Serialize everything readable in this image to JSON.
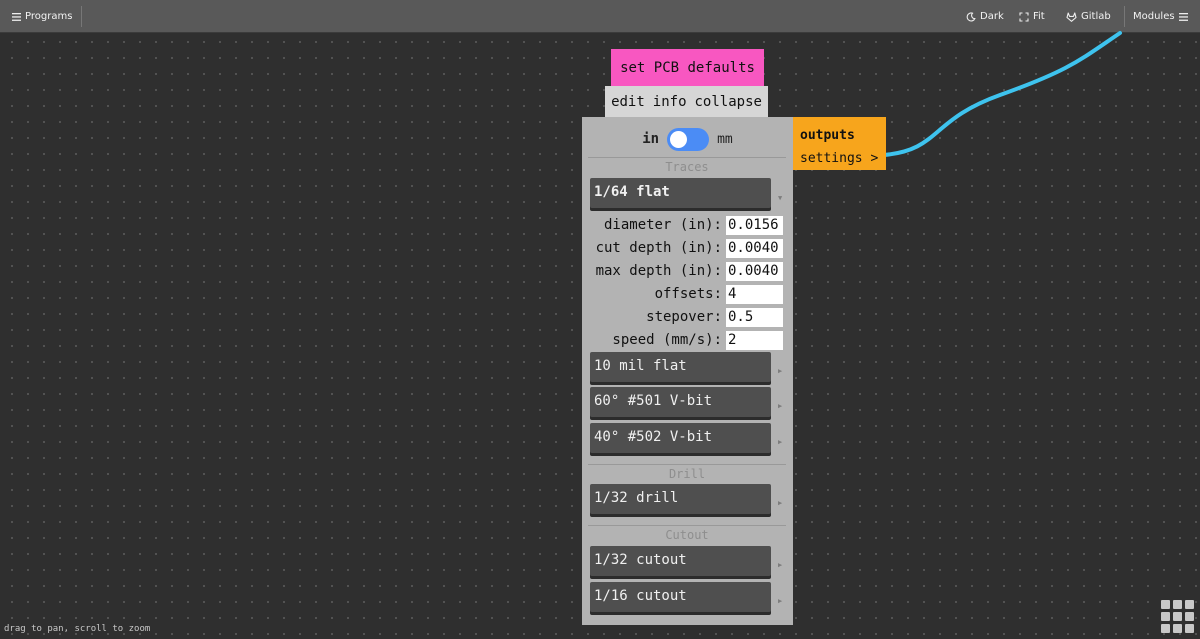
{
  "topbar": {
    "programs_label": "Programs",
    "dark_label": "Dark",
    "fit_label": "Fit",
    "gitlab_label": "Gitlab",
    "modules_label": "Modules"
  },
  "node": {
    "title": "set PCB defaults",
    "tabs": {
      "edit": "edit",
      "info": "info",
      "collapse": "collapse"
    },
    "units": {
      "left": "in",
      "right": "mm"
    },
    "outputs": {
      "title": "outputs",
      "port": "settings >"
    },
    "sections": {
      "traces": "Traces",
      "drill": "Drill",
      "cutout": "Cutout"
    },
    "tools": {
      "t1": "1/64 flat",
      "t2": "10 mil flat",
      "t3": "60° #501 V-bit",
      "t4": "40° #502 V-bit",
      "t5": "1/32 drill",
      "t6": "1/32 cutout",
      "t7": "1/16 cutout"
    },
    "arrow_expanded": "▼",
    "arrow_collapsed": "▶",
    "params": {
      "diameter": {
        "label": "diameter (in):",
        "value": "0.0156"
      },
      "cut_depth": {
        "label": "cut depth (in):",
        "value": "0.0040"
      },
      "max_depth": {
        "label": "max depth (in):",
        "value": "0.0040"
      },
      "offsets": {
        "label": "offsets:",
        "value": "4"
      },
      "stepover": {
        "label": "stepover:",
        "value": "0.5"
      },
      "speed": {
        "label": "speed (mm/s):",
        "value": "2"
      }
    }
  },
  "footer": {
    "hint": "drag to pan, scroll to zoom"
  },
  "colors": {
    "node_title": "#f857c1",
    "outputs": "#f7a51c",
    "wire": "#3ec3ee",
    "toggle": "#4b8cf5"
  },
  "icons": {
    "programs": "hamburger-icon",
    "dark": "moon-icon",
    "fit": "fit-icon",
    "gitlab": "gitlab-icon",
    "modules": "hamburger-icon",
    "grid": "grid-icon"
  }
}
